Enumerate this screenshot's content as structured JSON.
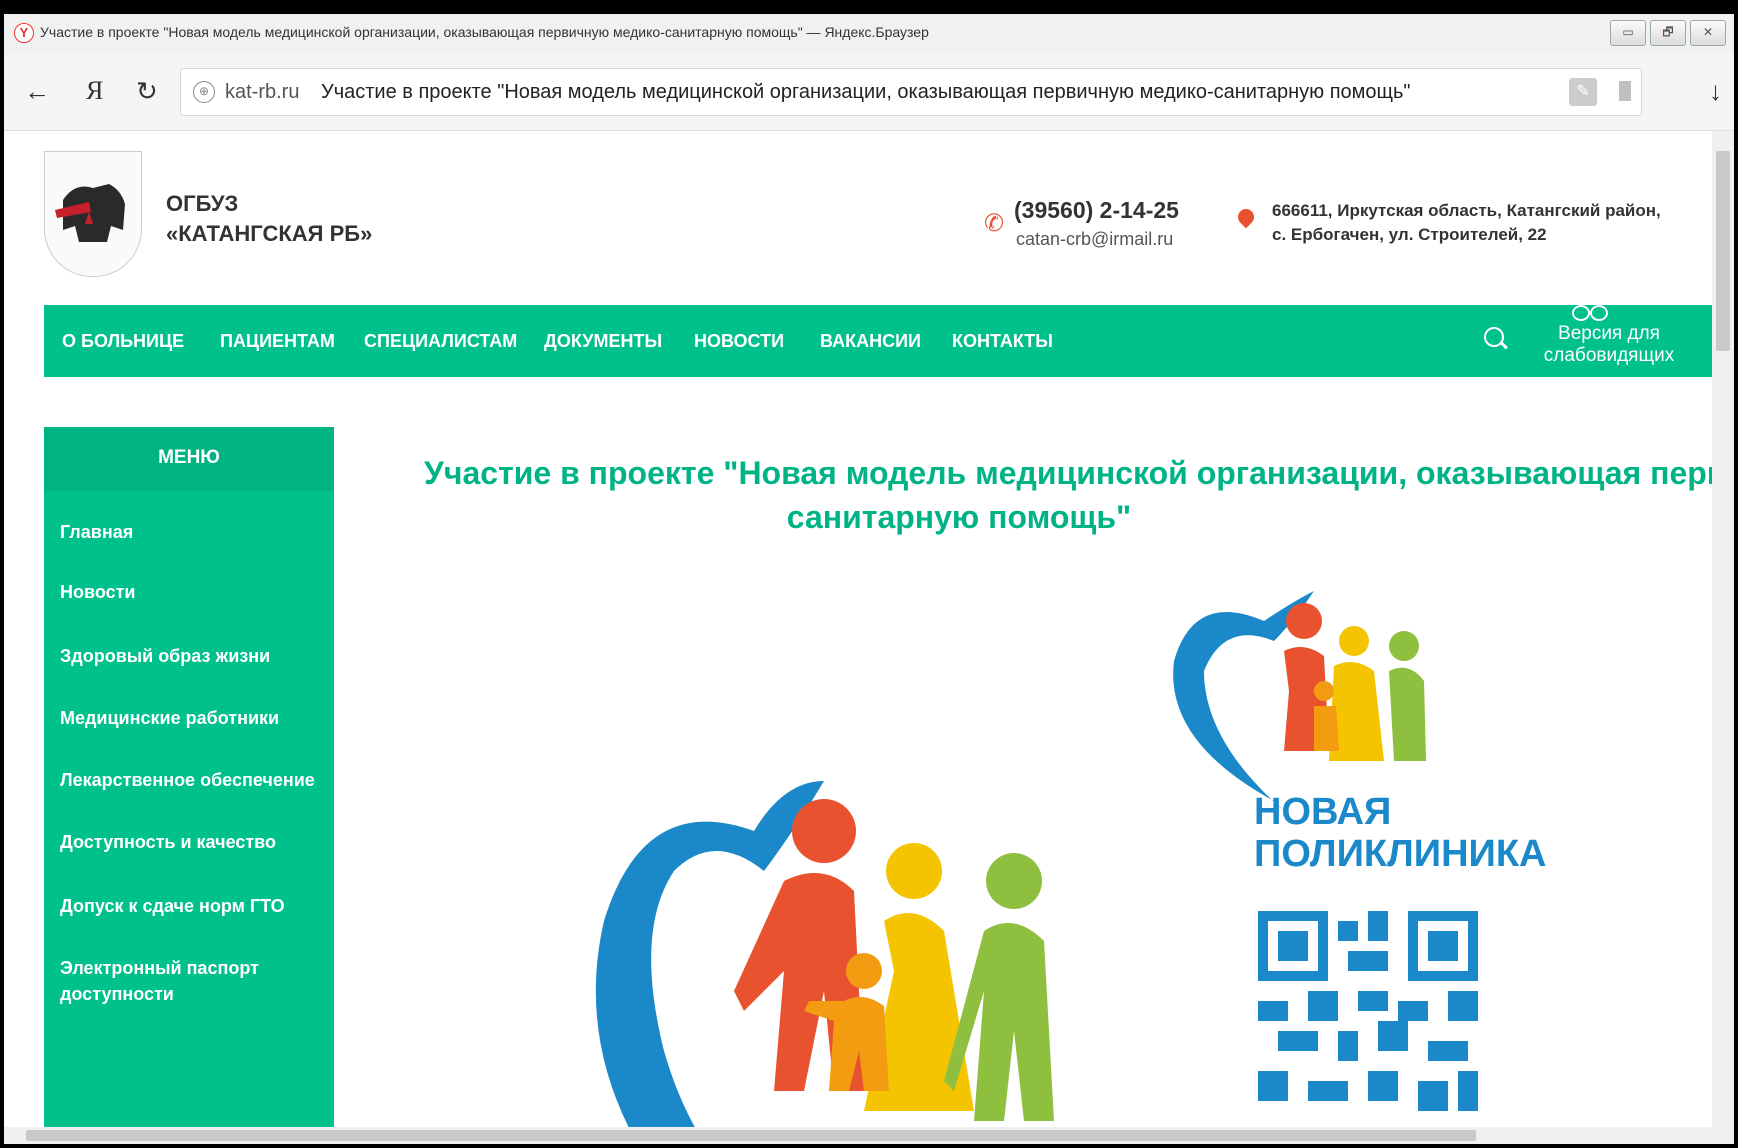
{
  "browser": {
    "logo": "Y",
    "window_title": "Участие в проекте \"Новая модель медицинской организации, оказывающая первичную медико-санитарную помощь\" — Яндекс.Браузер",
    "controls": [
      "▭",
      "🗗",
      "✕"
    ],
    "back_icon": "←",
    "yandex_icon": "Я",
    "reload_icon": "↻",
    "url_host": "kat-rb.ru",
    "url_title": "Участие в проекте \"Новая модель медицинской организации, оказывающая первичную медико-санитарную помощь\"",
    "download_icon": "↓"
  },
  "header": {
    "brand_line1": "ОГБУЗ",
    "brand_line2": "«КАТАНГСКАЯ РБ»",
    "phone": "(39560) 2-14-25",
    "email": "catan-crb@irmail.ru",
    "address_line1": "666611, Иркутская область, Катангский район,",
    "address_line2": "с. Ербогачен, ул. Строителей, 22"
  },
  "nav": {
    "items": [
      "О БОЛЬНИЦЕ",
      "ПАЦИЕНТАМ",
      "СПЕЦИАЛИСТАМ",
      "ДОКУМЕНТЫ",
      "НОВОСТИ",
      "ВАКАНСИИ",
      "КОНТАКТЫ"
    ],
    "vision_line1": "Версия для",
    "vision_line2": "слабовидящих"
  },
  "sidebar": {
    "title": "МЕНЮ",
    "items": [
      "Главная",
      "Новости",
      "Здоровый образ жизни",
      "Медицинские работники",
      "Лекарственное обеспечение",
      "Доступность и качество",
      "Допуск к сдаче норм ГТО",
      "Электронный паспорт доступности"
    ]
  },
  "main": {
    "title_line1": "Участие в проекте \"Новая модель медицинской организации, оказывающая первичную медико-",
    "title_line2": "санитарную помощь\"",
    "logo_line1": "НОВАЯ",
    "logo_line2": "ПОЛИКЛИНИКА"
  },
  "colors": {
    "brand_green": "#00c08b",
    "title_green": "#00b386",
    "heart_blue": "#1a88c9"
  }
}
